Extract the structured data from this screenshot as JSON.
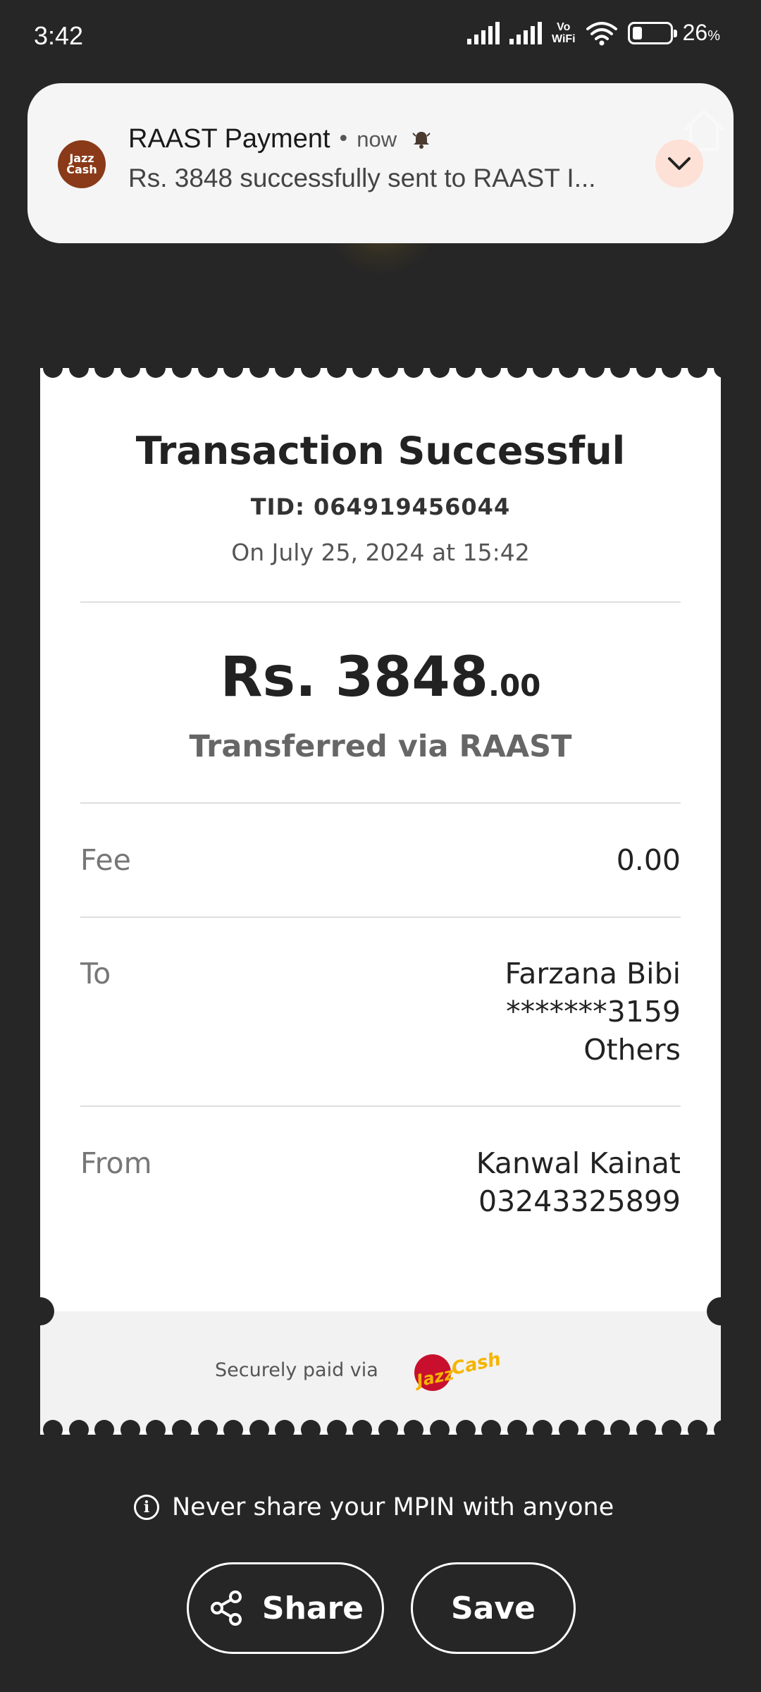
{
  "status_bar": {
    "time": "3:42",
    "vowifi_top": "Vo",
    "vowifi_bottom": "WiFi",
    "battery_level": 26,
    "battery_percent": "26",
    "percent_sign": "%"
  },
  "notification": {
    "app_icon_text": "Jazz Cash",
    "title": "RAAST Payment",
    "separator": "•",
    "time": "now",
    "text": "Rs. 3848 successfully sent to RAAST I...",
    "icons": [
      "bell-icon",
      "chevron-down-icon",
      "home-icon"
    ]
  },
  "receipt": {
    "title": "Transaction Successful",
    "tid": "TID: 064919456044",
    "date": "On July 25, 2024 at 15:42",
    "amount_main": "Rs. 3848",
    "amount_decimal": ".00",
    "via": "Transferred via RAAST",
    "fee": {
      "label": "Fee",
      "value": "0.00"
    },
    "to": {
      "label": "To",
      "name": "Farzana Bibi",
      "account": "*******3159",
      "bank": "Others"
    },
    "from": {
      "label": "From",
      "name": "Kanwal Kainat",
      "number": "03243325899"
    },
    "secure_text": "Securely paid via",
    "logo_text": "JazzCash"
  },
  "warning": {
    "text": "Never share your MPIN with anyone",
    "icon": "info-icon"
  },
  "actions": {
    "share_label": "Share",
    "save_label": "Save"
  }
}
